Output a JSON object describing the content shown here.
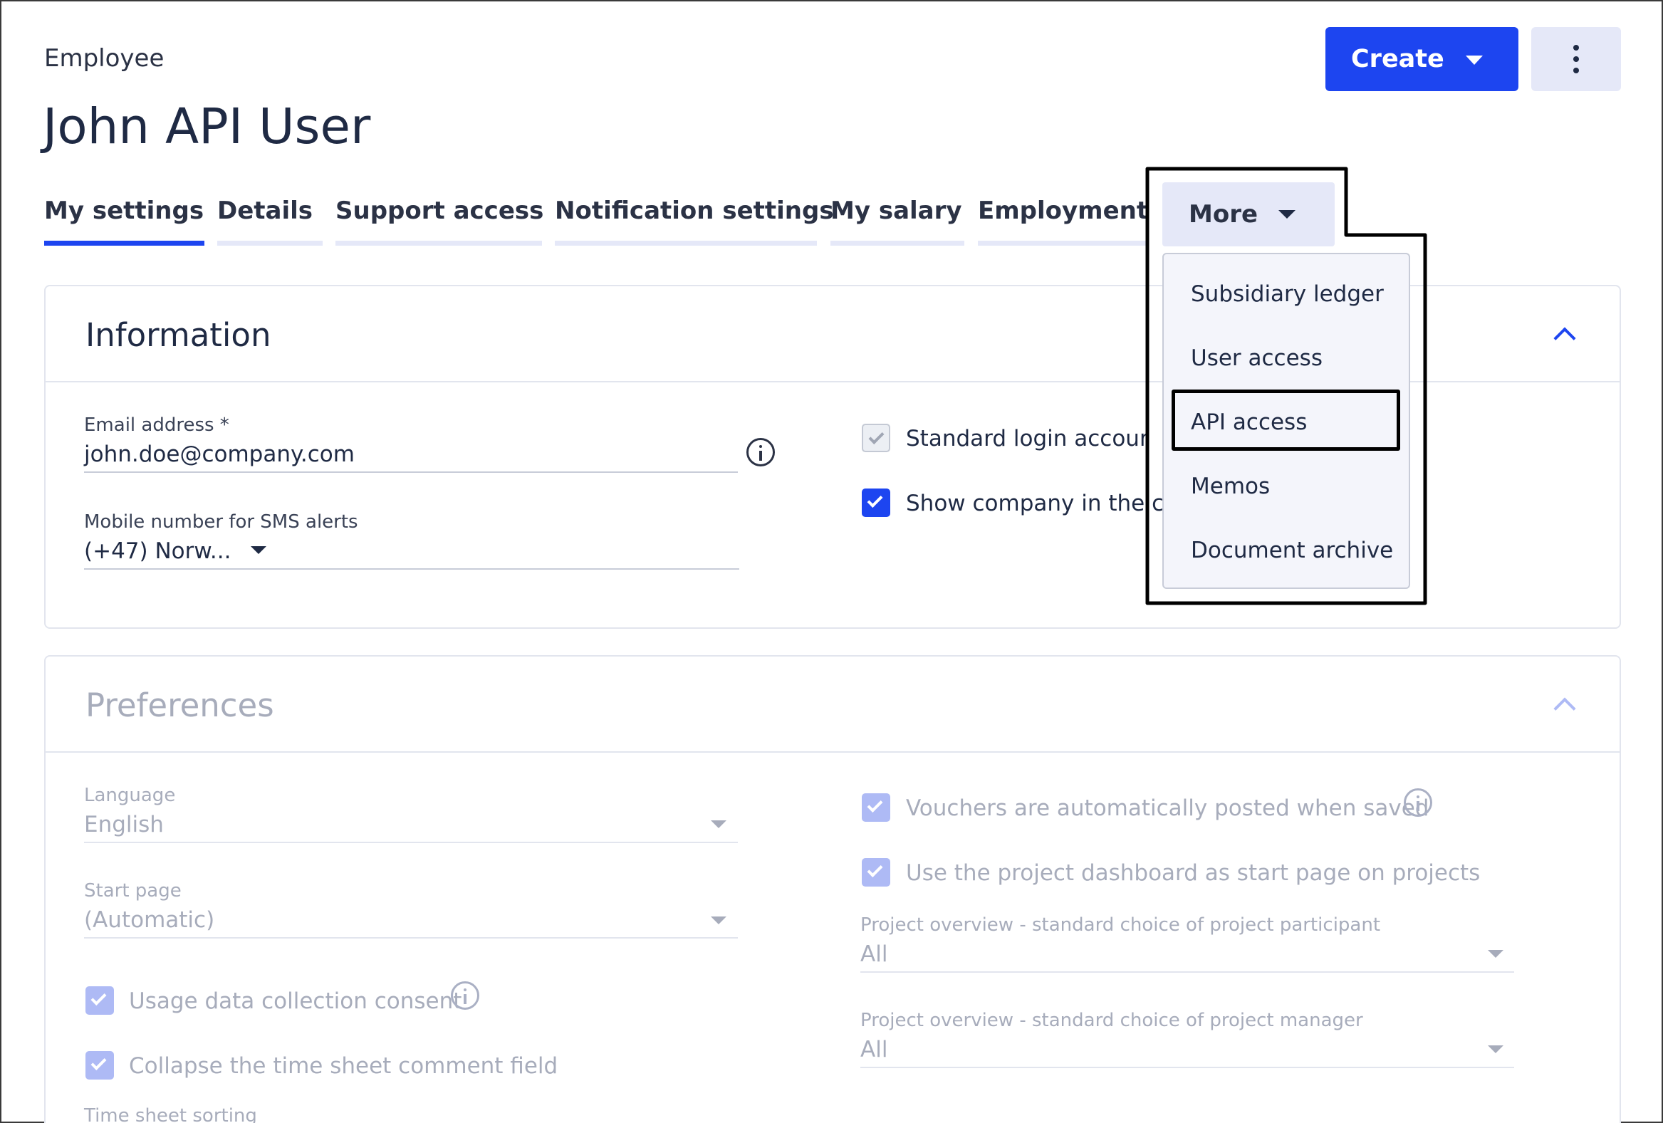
{
  "header": {
    "breadcrumb": "Employee",
    "title": "John API User",
    "create_label": "Create"
  },
  "tabs": [
    {
      "label": "My settings",
      "active": true
    },
    {
      "label": "Details",
      "active": false
    },
    {
      "label": "Support access",
      "active": false
    },
    {
      "label": "Notification settings",
      "active": false
    },
    {
      "label": "My salary",
      "active": false
    },
    {
      "label": "Employment",
      "active": false
    }
  ],
  "more_tab": {
    "label": "More"
  },
  "more_menu": {
    "items": [
      "Subsidiary ledger",
      "User access",
      "API access",
      "Memos",
      "Document archive"
    ],
    "highlighted": "API access"
  },
  "information": {
    "title": "Information",
    "email_label": "Email address *",
    "email_value": "john.doe@company.com",
    "mobile_label": "Mobile number for SMS alerts",
    "mobile_value": "(+47) Norw...",
    "standard_login_label": "Standard login account",
    "standard_login_checked": true,
    "show_company_label": "Show company in the co",
    "show_company_checked": true
  },
  "preferences": {
    "title": "Preferences",
    "language_label": "Language",
    "language_value": "English",
    "start_page_label": "Start page",
    "start_page_value": "(Automatic)",
    "usage_consent_label": "Usage data collection consent",
    "collapse_comment_label": "Collapse the time sheet comment field",
    "time_sheet_sorting_label": "Time sheet sorting",
    "vouchers_label": "Vouchers are automatically posted when saved",
    "project_dashboard_label": "Use the project dashboard as start page on projects",
    "participant_label": "Project overview - standard choice of project participant",
    "participant_value": "All",
    "manager_label": "Project overview - standard choice of project manager",
    "manager_value": "All"
  },
  "colors": {
    "accent": "#1d45f0",
    "tab_inactive_underline": "#e5e8f8",
    "disabled_text": "#a7acbb"
  }
}
